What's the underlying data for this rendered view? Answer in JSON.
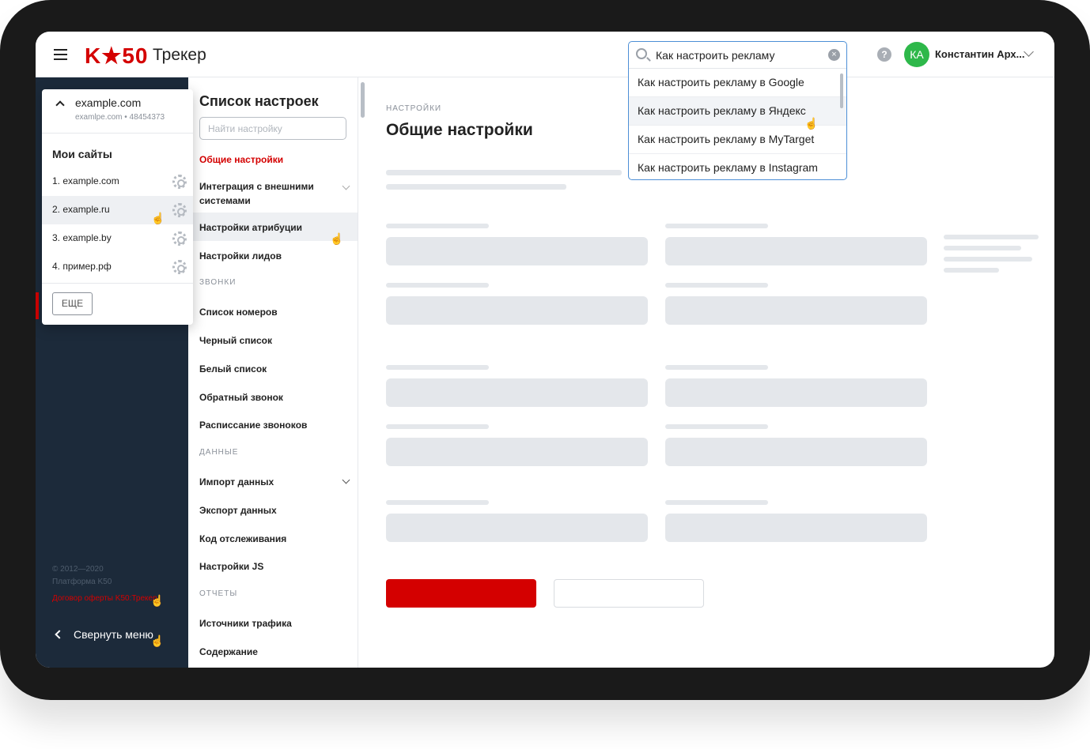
{
  "header": {
    "logo": "K★50",
    "product": "Трекер",
    "search_value": "Как настроить рекламу",
    "search_suggestions": [
      "Как настроить рекламу в Google",
      "Как настроить рекламу в Яндекс",
      "Как настроить рекламу в MyTarget",
      "Как настроить рекламу в Instagram"
    ],
    "help_icon": "?",
    "avatar_initials": "КА",
    "avatar_color": "#2eb84a",
    "user_name": "Константин Арх..."
  },
  "sidebar": {
    "current_site": "example.com",
    "current_site_sub": "examlpe.com • 48454373",
    "my_sites_label": "Мои сайты",
    "sites": [
      "1. example.com",
      "2. example.ru",
      "3. example.by",
      "4. пример.рф"
    ],
    "more_label": "ЕЩЕ",
    "copyright_line1": "© 2012—2020",
    "copyright_line2": "Платформа K50",
    "offer_link": "Договор оферты K50:Трекер",
    "collapse_label": "Свернуть меню"
  },
  "settings_list": {
    "title": "Список настроек",
    "search_placeholder": "Найти настройку",
    "items": {
      "general": "Общие настройки",
      "integration": "Интеграция с внешними системами",
      "attribution": "Настройки атрибуции",
      "leads": "Настройки лидов",
      "calls_section": "ЗВОНКИ",
      "numbers": "Список номеров",
      "blacklist": "Черный список",
      "whitelist": "Белый список",
      "callback": "Обратный звонок",
      "schedule": "Расписсание звонокoв",
      "data_section": "ДАННЫЕ",
      "import": "Импорт данных",
      "export": "Экспорт данных",
      "tracking_code": "Код отслеживания",
      "js_settings": "Настройки JS",
      "reports_section": "ОТЧЕТЫ",
      "traffic_sources": "Источники трафика",
      "content": "Содержание"
    }
  },
  "main": {
    "breadcrumb": "НАСТРОЙКИ",
    "page_title": "Общие настройки"
  },
  "colors": {
    "accent": "#d40000",
    "sidebar_bg": "#1c2a3a",
    "focus": "#4d8fd6"
  }
}
